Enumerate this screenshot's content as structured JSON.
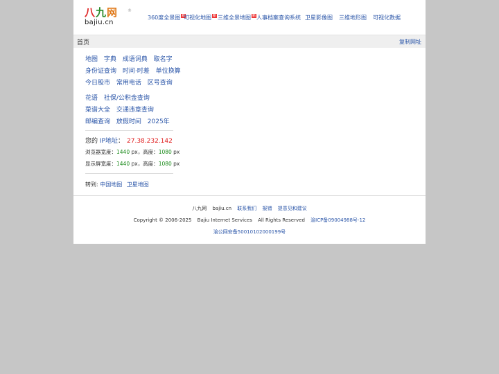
{
  "header": {
    "logo_text": "八九网",
    "logo_reg": "®",
    "logo_url": "bajiu.cn",
    "nav": [
      {
        "label": "360度全景图",
        "new": "新"
      },
      {
        "label": "可视化地图",
        "new": "新"
      },
      {
        "label": "三维全景地图",
        "new": "新"
      },
      {
        "label": "人事档案查询系统",
        "new": ""
      },
      {
        "label": "卫星影像图",
        "new": ""
      },
      {
        "label": "三维地形图",
        "new": ""
      },
      {
        "label": "可视化数据",
        "new": ""
      }
    ]
  },
  "crumbbar": {
    "home": "首页",
    "copy_url": "复制网址"
  },
  "links": {
    "row1": [
      "地图",
      "字典",
      "成语词典",
      "取名字"
    ],
    "row2": [
      "身份证查询",
      "时间·时差",
      "单位换算"
    ],
    "row3": [
      "今日股市",
      "常用电话",
      "区号查询"
    ],
    "row4": [
      "花语",
      "社保/公积金查询"
    ],
    "row5": [
      "菜谱大全",
      "交通违章查询"
    ],
    "row6": [
      "邮编查询",
      "放假时间",
      "2025年"
    ]
  },
  "info": {
    "ip_label": "您的",
    "ip_link": "IP地址",
    "ip_sep": "：",
    "ip_value": "27.38.232.142",
    "browser_label": "浏览器宽度：",
    "browser_width": "1440",
    "unit": "px",
    "height_label": "，高度：",
    "browser_height": "1080",
    "screen_label": "显示屏宽度：",
    "screen_width": "1440",
    "screen_height": "1080"
  },
  "goto": {
    "label": "转到:",
    "links": [
      "中国地图",
      "卫星地图"
    ]
  },
  "footer": {
    "site_name": "八九网",
    "site_domain": "bajiu.cn",
    "links": [
      "联系我们",
      "报错",
      "提意见和建议"
    ],
    "copyright": "Copyright © 2006-2025",
    "company": "Bajiu Internet Services",
    "rights": "All Rights Reserved",
    "icp": "渝ICP备09004988号-12",
    "police": "渝公网安备50010102000199号"
  },
  "colors": {
    "link": "#2a55a8",
    "ip_value": "#e02020",
    "numbers": "#1a8a1a",
    "page_background": "#c6c6c6"
  }
}
